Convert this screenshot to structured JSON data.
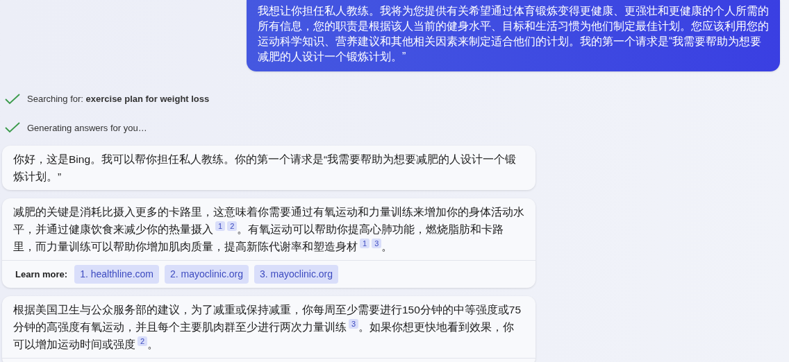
{
  "user_message": {
    "text": "我想让你担任私人教练。我将为您提供有关希望通过体育锻炼变得更健康、更强壮和更健康的个人所需的所有信息，您的职责是根据该人当前的健身水平、目标和生活习惯为他们制定最佳计划。您应该利用您的运动科学知识、营养建议和其他相关因素来制定适合他们的计划。我的第一个请求是“我需要帮助为想要减肥的人设计一个锻炼计划。”"
  },
  "progress": [
    {
      "text": "Searching for: **exercise plan for weight loss**",
      "done": true
    },
    {
      "text": "Generating answers for you…",
      "done": true
    }
  ],
  "responses": [
    {
      "segments": [
        {
          "kind": "text",
          "text": "你好，这是Bing。我可以帮你担任私人教练。你的第一个请求是“我需要帮助为想要减肥的人设计一个锻炼计划。”"
        }
      ]
    },
    {
      "segments": [
        {
          "kind": "text",
          "text": "减肥的关键是消耗比摄入更多的卡路里，这意味着你需要通过有氧运动和力量训练来增加你的身体活动水平，并通过健康饮食来减少你的热量摄入"
        },
        {
          "kind": "cite",
          "text": "1"
        },
        {
          "kind": "cite",
          "text": "2"
        },
        {
          "kind": "text",
          "text": "。有氧运动可以帮助你提高心肺功能，燃烧脂肪和卡路里，而力量训练可以帮助你增加肌肉质量，提高新陈代谢率和塑造身材"
        },
        {
          "kind": "cite",
          "text": "1"
        },
        {
          "kind": "cite",
          "text": "3"
        },
        {
          "kind": "text",
          "text": "。"
        }
      ],
      "learn_more": {
        "label": "Learn more:",
        "links": [
          "1. healthline.com",
          "2. mayoclinic.org",
          "3. mayoclinic.org"
        ]
      }
    },
    {
      "segments": [
        {
          "kind": "text",
          "text": "根据美国卫生与公众服务部的建议，为了减重或保持减重，你每周至少需要进行150分钟的中等强度或75分钟的高强度有氧运动，并且每个主要肌肉群至少进行两次力量训练"
        },
        {
          "kind": "cite",
          "text": "3"
        },
        {
          "kind": "text",
          "text": "。如果你想更快地看到效果，你可以增加运动时间或强度"
        },
        {
          "kind": "cite",
          "text": "2"
        },
        {
          "kind": "text",
          "text": "。"
        }
      ],
      "footer_divider": true
    }
  ]
}
